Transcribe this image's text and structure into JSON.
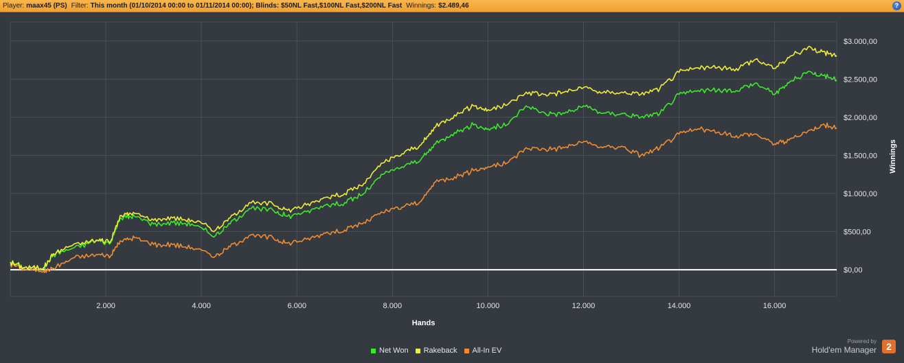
{
  "header": {
    "player_label": "Player:",
    "player_value": "maax45 (PS)",
    "filter_label": "Filter:",
    "filter_value": "This month (01/10/2014 00:00 to 01/11/2014 00:00); Blinds: $50NL Fast,$100NL Fast,$200NL Fast",
    "winnings_label": "Winnings:",
    "winnings_value": "$2.489,46",
    "help_label": "?"
  },
  "colors": {
    "background": "#353a40",
    "grid": "#4a5058",
    "zero_line": "#ffffff",
    "net_won": "#3ee82e",
    "rakeback": "#f0ee3a",
    "allin_ev": "#f08c32"
  },
  "chart_data": {
    "type": "line",
    "xlabel": "Hands",
    "ylabel": "Winnings",
    "xlim": [
      0,
      17300
    ],
    "ylim": [
      -350,
      3250
    ],
    "x_ticks": [
      2000,
      4000,
      6000,
      8000,
      10000,
      12000,
      14000,
      16000
    ],
    "x_tick_labels": [
      "2.000",
      "4.000",
      "6.000",
      "8.000",
      "10.000",
      "12.000",
      "14.000",
      "16.000"
    ],
    "y_ticks": [
      0,
      500,
      1000,
      1500,
      2000,
      2500,
      3000
    ],
    "y_tick_labels": [
      "$0,00",
      "$500,00",
      "$1.000,00",
      "$1.500,00",
      "$2.000,00",
      "$2.500,00",
      "$3.000,00"
    ],
    "grid": true,
    "legend_position": "bottom-center",
    "x": [
      0,
      300,
      700,
      900,
      1300,
      1800,
      2100,
      2300,
      2600,
      3000,
      3400,
      3800,
      4300,
      4600,
      5000,
      5500,
      5800,
      6200,
      6600,
      7000,
      7400,
      7800,
      8200,
      8600,
      8900,
      9300,
      9700,
      10000,
      10400,
      10800,
      11200,
      11600,
      12000,
      12400,
      12800,
      13200,
      13600,
      14000,
      14400,
      14800,
      15200,
      15600,
      16000,
      16300,
      16700,
      17000,
      17300
    ],
    "series": [
      {
        "name": "Net Won",
        "values": [
          100,
          30,
          20,
          200,
          280,
          380,
          350,
          680,
          700,
          600,
          620,
          600,
          450,
          600,
          800,
          780,
          700,
          760,
          850,
          880,
          1000,
          1250,
          1350,
          1450,
          1650,
          1800,
          1900,
          1850,
          1900,
          2150,
          2050,
          2050,
          2150,
          2050,
          2050,
          2000,
          2050,
          2300,
          2350,
          2350,
          2350,
          2450,
          2300,
          2450,
          2600,
          2550,
          2489
        ]
      },
      {
        "name": "Rakeback",
        "values": [
          100,
          30,
          30,
          210,
          320,
          390,
          370,
          710,
          740,
          650,
          680,
          650,
          520,
          680,
          880,
          860,
          780,
          850,
          950,
          1000,
          1130,
          1400,
          1520,
          1640,
          1870,
          2030,
          2150,
          2100,
          2160,
          2330,
          2300,
          2330,
          2390,
          2320,
          2330,
          2300,
          2380,
          2590,
          2650,
          2650,
          2640,
          2760,
          2640,
          2780,
          2920,
          2860,
          2810
        ]
      },
      {
        "name": "All-In EV",
        "values": [
          70,
          10,
          -20,
          20,
          150,
          200,
          180,
          380,
          420,
          330,
          330,
          290,
          180,
          300,
          450,
          420,
          350,
          400,
          480,
          520,
          620,
          750,
          820,
          900,
          1150,
          1220,
          1300,
          1350,
          1400,
          1600,
          1580,
          1600,
          1680,
          1600,
          1620,
          1500,
          1600,
          1780,
          1850,
          1800,
          1760,
          1780,
          1650,
          1700,
          1820,
          1900,
          1860
        ]
      }
    ]
  },
  "legend": {
    "net_won": "Net Won",
    "rakeback": "Rakeback",
    "allin_ev": "All-In EV"
  },
  "branding": {
    "powered_by": "Powered by",
    "name": "Hold'em Manager",
    "logo_text": "2"
  }
}
